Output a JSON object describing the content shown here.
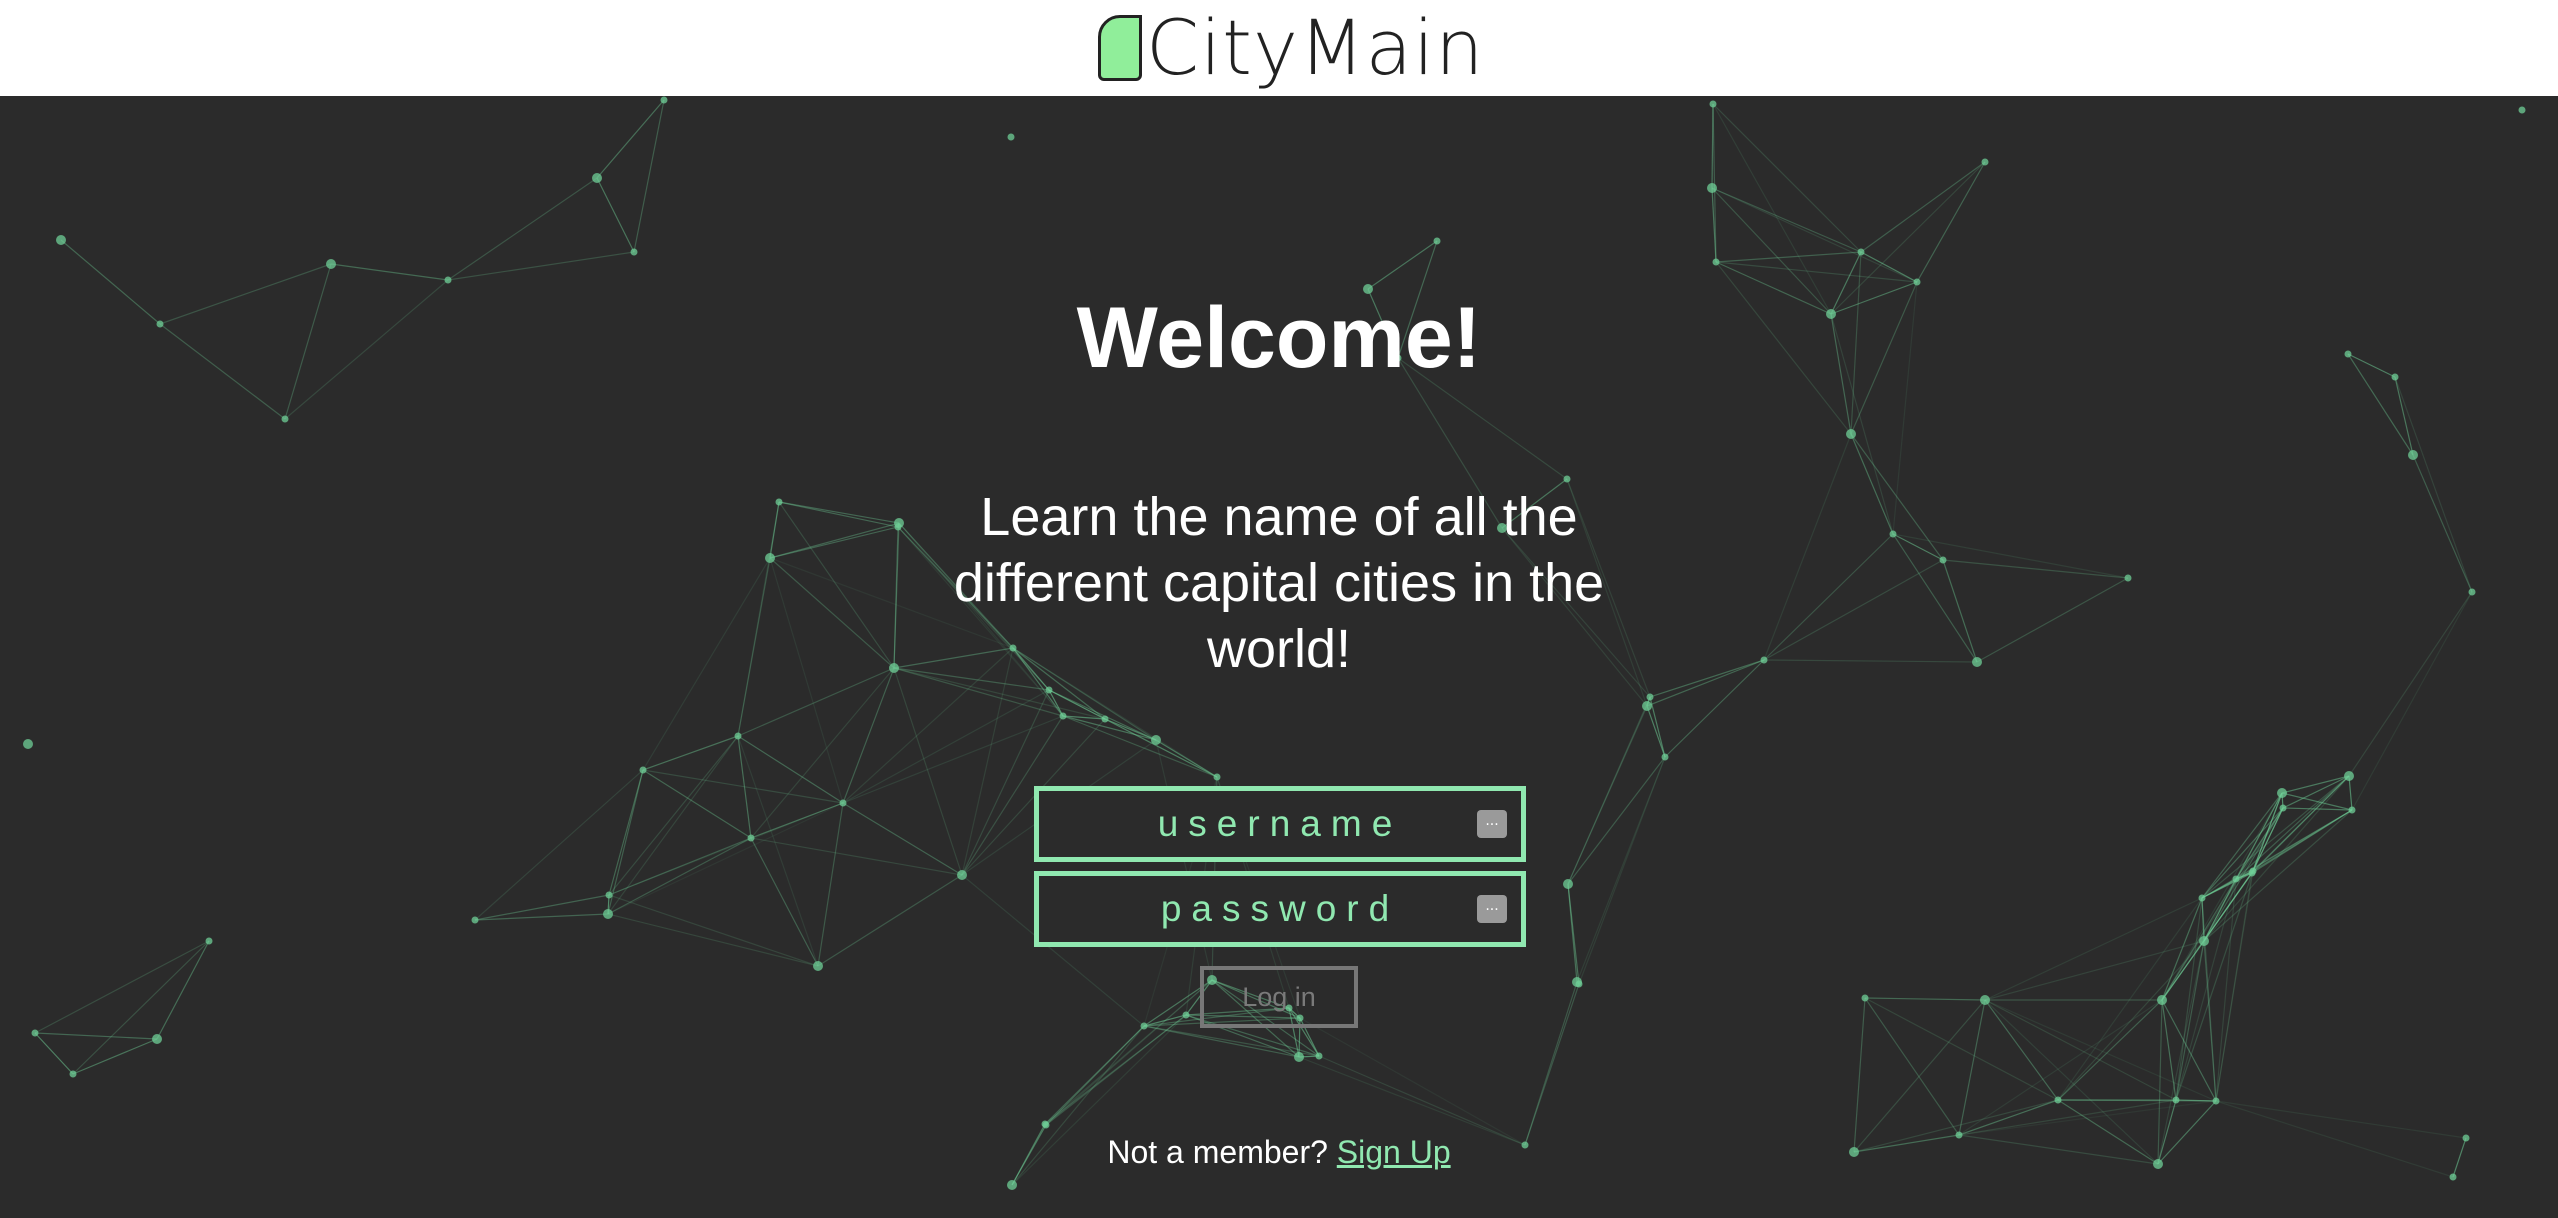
{
  "header": {
    "logo_text": "CityMain"
  },
  "main": {
    "title": "Welcome!",
    "subtitle": "Learn the name of all the different capital cities in the world!"
  },
  "form": {
    "username_placeholder": "username",
    "password_placeholder": "password",
    "field_icon": "...",
    "login_label": "Log in"
  },
  "footer": {
    "prompt": "Not a member?",
    "signup_label": "Sign Up"
  },
  "colors": {
    "background": "#2b2b2b",
    "accent": "#90e8b0",
    "logo_mark": "#90ee9a",
    "network": "#6fcf97"
  },
  "icons": {
    "logo": "logo-mark-icon",
    "field": "password-manager-key-icon",
    "background": "particle-network-background"
  }
}
